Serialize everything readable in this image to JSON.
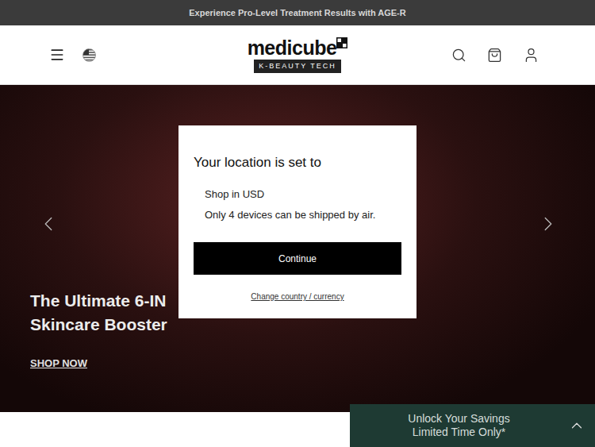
{
  "announcement": "Experience Pro-Level Treatment Results with AGE-R",
  "logo": {
    "name": "medicube",
    "tagline": "K-BEAUTY TECH"
  },
  "hero": {
    "title_lines": [
      "The Ultimate 6-IN",
      "Skincare Booster"
    ],
    "cta": "SHOP NOW"
  },
  "modal": {
    "title": "Your location is set to",
    "lines": [
      "Shop in USD",
      "Only 4 devices can be shipped by air."
    ],
    "primary_button": "Continue",
    "link": "Change country / currency"
  },
  "promo": {
    "lines": [
      "Unlock Your Savings",
      "Limited Time Only*"
    ]
  }
}
